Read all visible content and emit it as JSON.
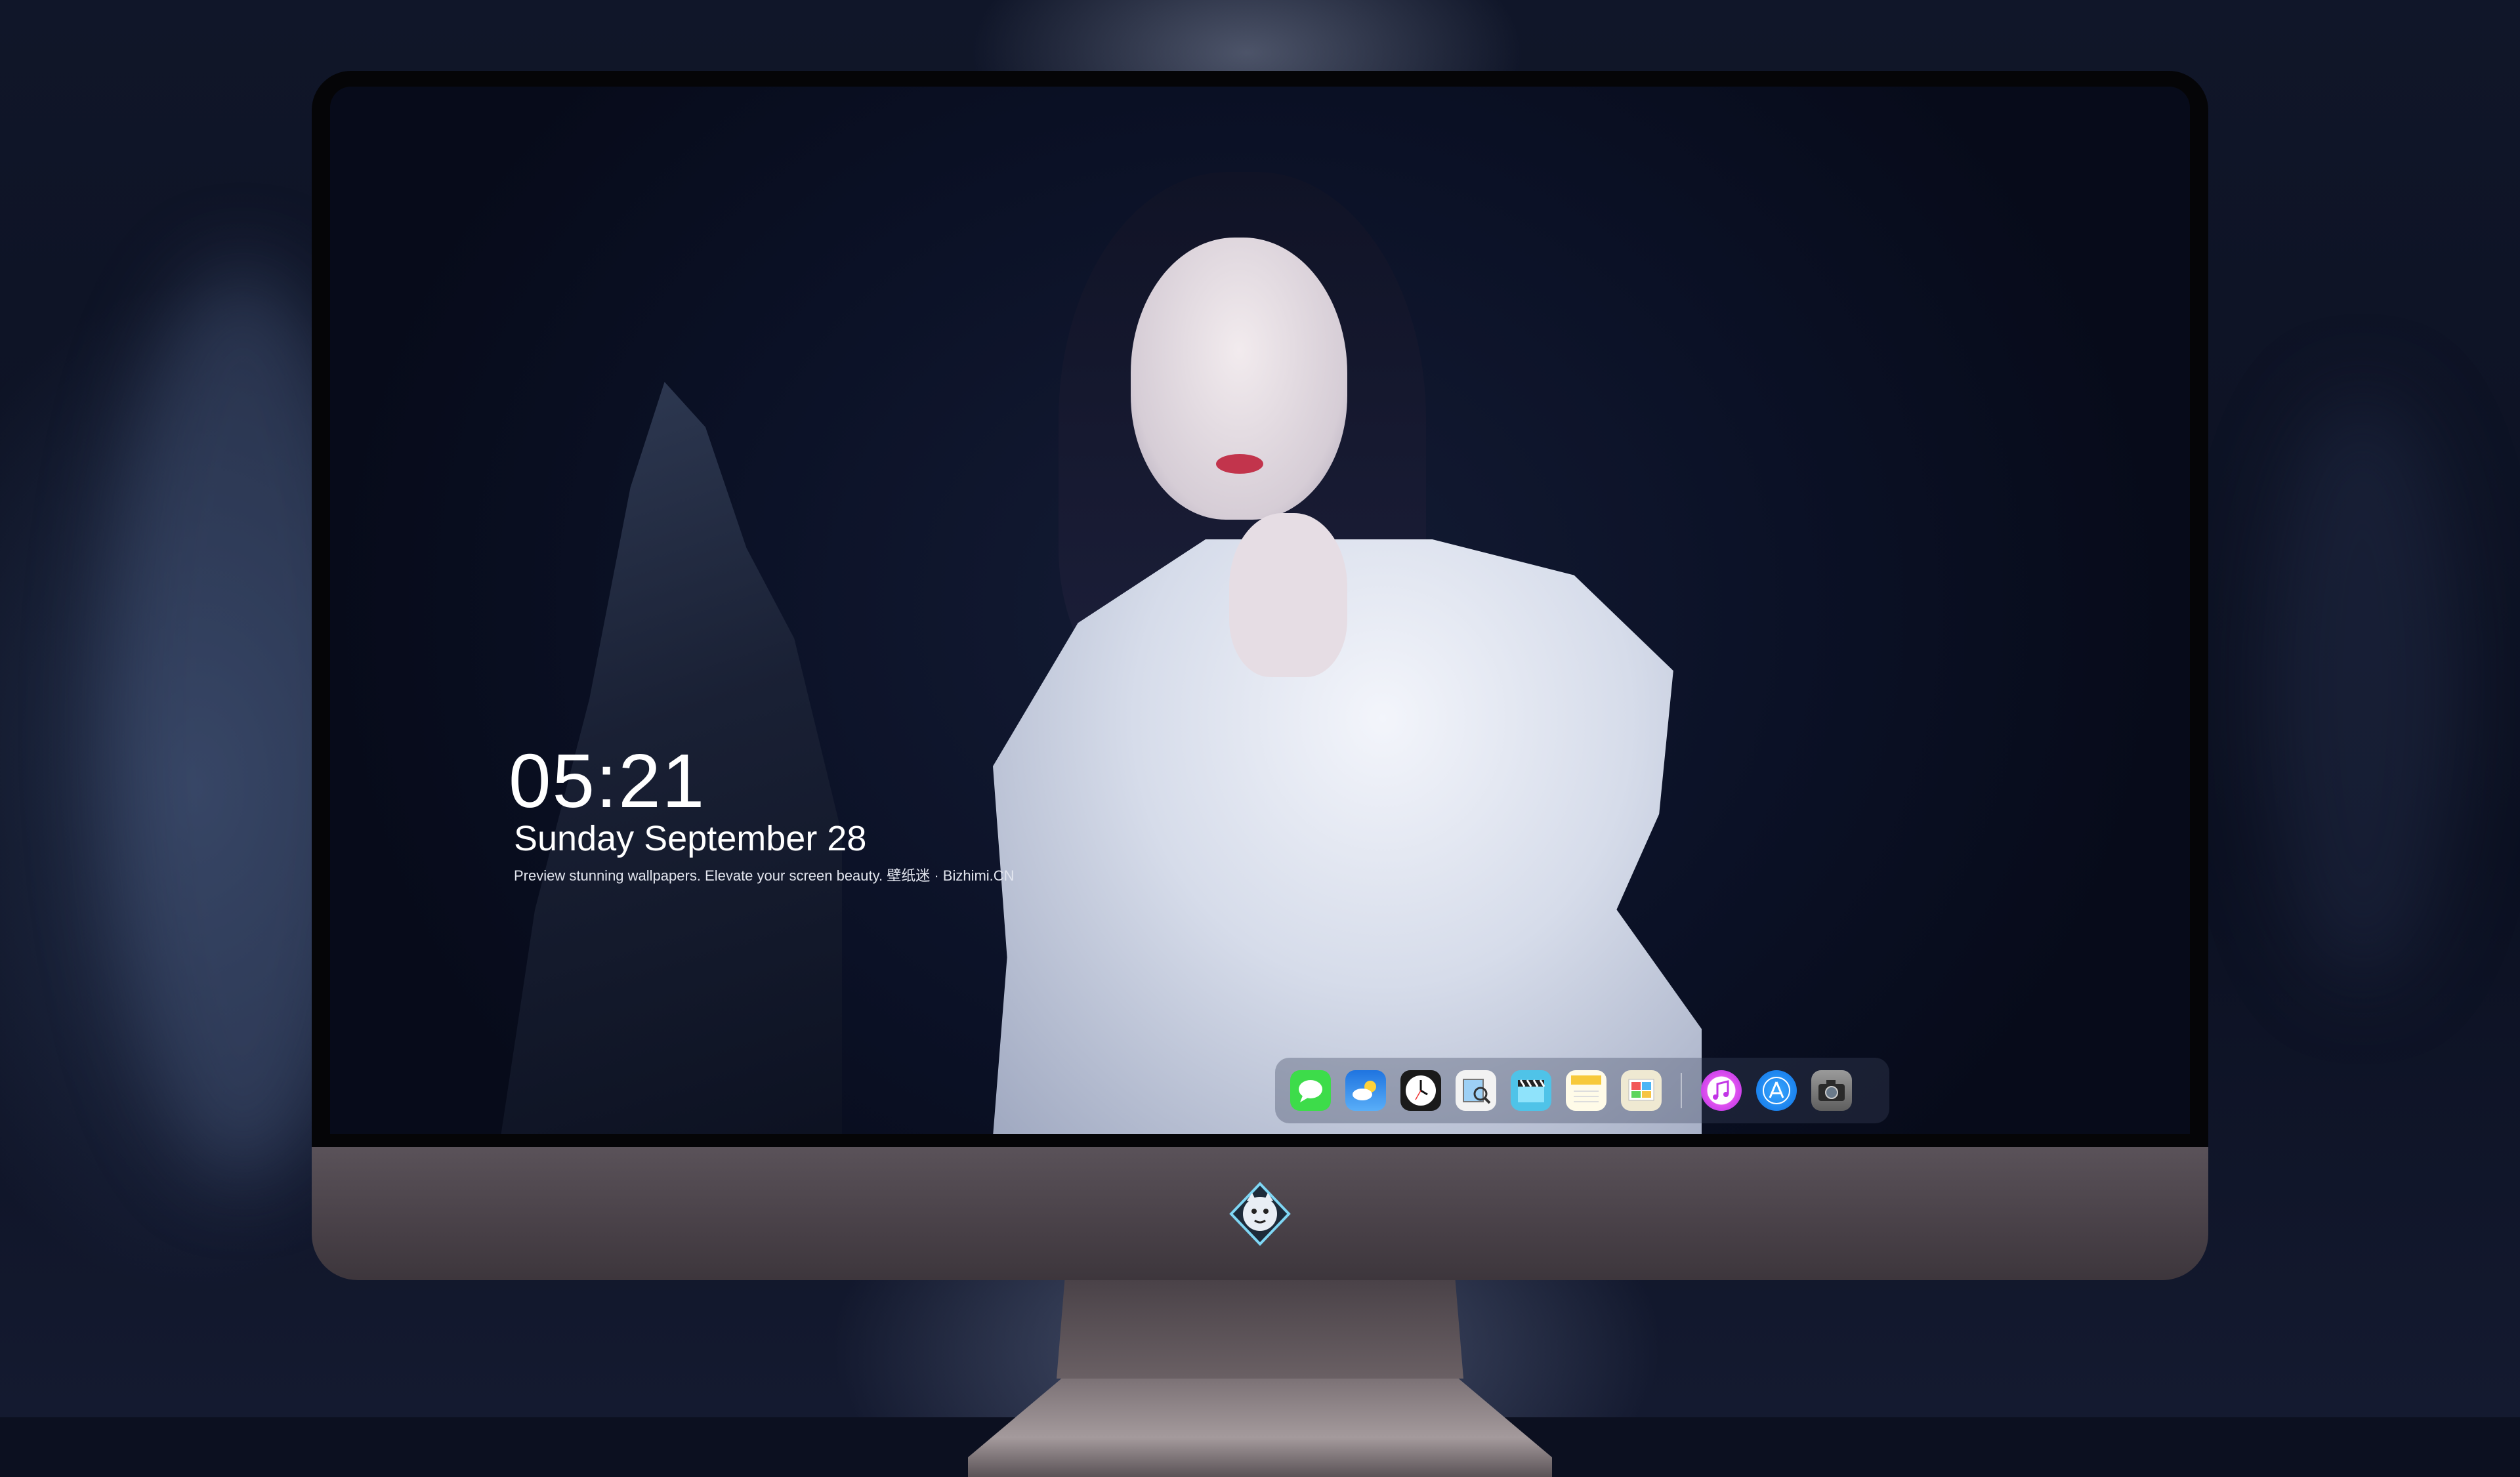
{
  "lockscreen": {
    "time": "05:21",
    "date": "Sunday September  28",
    "tagline": "Preview stunning wallpapers. Elevate your screen beauty. 壁纸迷 · Bizhimi.CN"
  },
  "dock": {
    "items": [
      {
        "name": "messages-icon",
        "color": "#3ddc4a"
      },
      {
        "name": "weather-icon",
        "color": "#2f8ef2"
      },
      {
        "name": "clock-icon",
        "color": "#1a1a1a"
      },
      {
        "name": "preview-icon",
        "color": "#e7d27a"
      },
      {
        "name": "video-clapper-icon",
        "color": "#4fc3e8"
      },
      {
        "name": "notes-icon",
        "color": "#f7d04a"
      },
      {
        "name": "photo-slides-icon",
        "color": "#e9e2c6"
      },
      {
        "name": "music-icon",
        "color": "#d83ff0"
      },
      {
        "name": "app-store-icon",
        "color": "#1b8cf5"
      },
      {
        "name": "camera-icon",
        "color": "#8c8c8c"
      }
    ]
  },
  "monitor": {
    "logo": "shield-mascot-icon"
  }
}
